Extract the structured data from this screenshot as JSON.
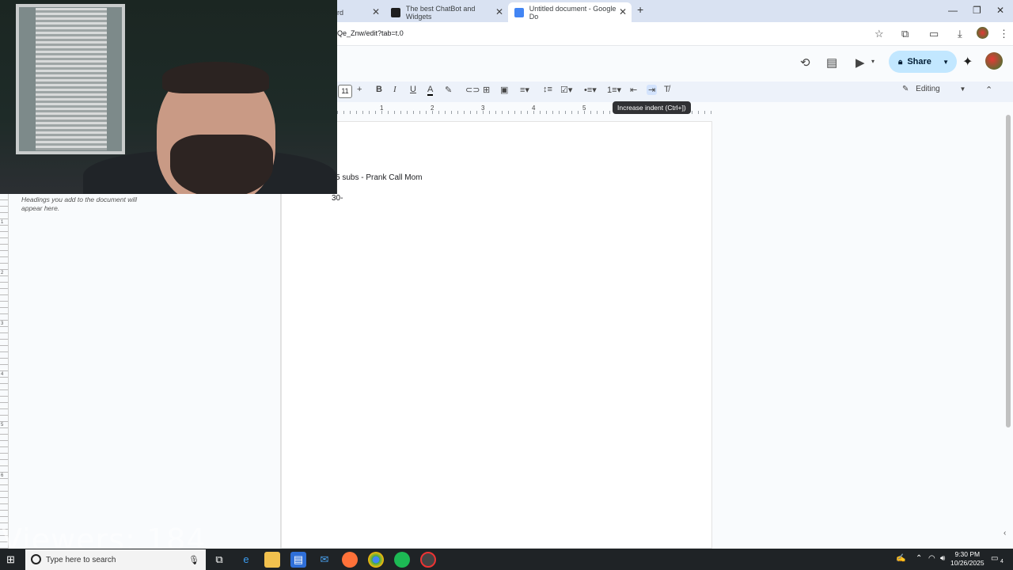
{
  "browser": {
    "tabs": [
      {
        "label": "rd",
        "active": false
      },
      {
        "label": "The best ChatBot and Widgets",
        "active": false
      },
      {
        "label": "Untitled document - Google Do",
        "active": true
      }
    ],
    "new_tab": "+",
    "url": "Qe_Znw/edit?tab=t.0"
  },
  "docs": {
    "share_label": "Share",
    "editing_label": "Editing",
    "font_size": "11",
    "tooltip": "Increase indent (Ctrl+])",
    "ruler_numbers": [
      "1",
      "2",
      "3",
      "4",
      "5"
    ],
    "vruler_numbers": [
      "1",
      "2",
      "3",
      "4",
      "5",
      "6"
    ],
    "outline_hint": "Headings you add to the document will appear here.",
    "lines": [
      "5 subs - Prank Call Mom",
      "30-"
    ]
  },
  "overlay": {
    "viewers": "Viewers: 184"
  },
  "taskbar": {
    "search_placeholder": "Type here to search",
    "time": "9:30 PM",
    "date": "10/26/2025",
    "notification_count": "4"
  },
  "colors": {
    "share_bg": "#c2e7ff",
    "tabstrip": "#d9e2f2",
    "toolbar": "#edf2fa",
    "taskbar": "#1f2326"
  }
}
